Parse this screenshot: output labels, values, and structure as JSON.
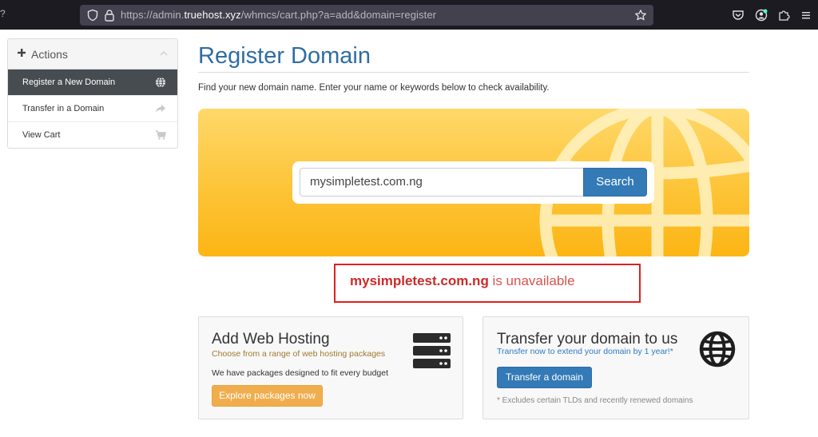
{
  "browser": {
    "url_prefix": "https://admin.",
    "url_host": "truehost.xyz",
    "url_path": "/whmcs/cart.php?a=add&domain=register"
  },
  "sidebar": {
    "header": "Actions",
    "items": [
      {
        "label": "Register a New Domain",
        "icon": "globe-icon",
        "active": true
      },
      {
        "label": "Transfer in a Domain",
        "icon": "share-arrow-icon",
        "active": false
      },
      {
        "label": "View Cart",
        "icon": "cart-icon",
        "active": false
      }
    ]
  },
  "main": {
    "title": "Register Domain",
    "intro": "Find your new domain name. Enter your name or keywords below to check availability.",
    "search": {
      "value": "mysimpletest.com.ng",
      "button_label": "Search"
    },
    "result": {
      "domain": "mysimpletest.com.ng",
      "status_text": " is unavailable"
    }
  },
  "cards": {
    "hosting": {
      "title": "Add Web Hosting",
      "subtitle": "Choose from a range of web hosting packages",
      "body": "We have packages designed to fit every budget",
      "button_label": "Explore packages now",
      "icon": "server-icon"
    },
    "transfer": {
      "title": "Transfer your domain to us",
      "subtitle": "Transfer now to extend your domain by 1 year!*",
      "button_label": "Transfer a domain",
      "note": "* Excludes certain TLDs and recently renewed domains",
      "icon": "globe-icon"
    }
  },
  "colors": {
    "accent_blue": "#337ab7",
    "title_blue": "#2e6da4",
    "hero_yellow": "#fdc437",
    "orange_button": "#f0ad4e",
    "error_red": "#d9534f",
    "sidebar_active": "#474c51"
  }
}
